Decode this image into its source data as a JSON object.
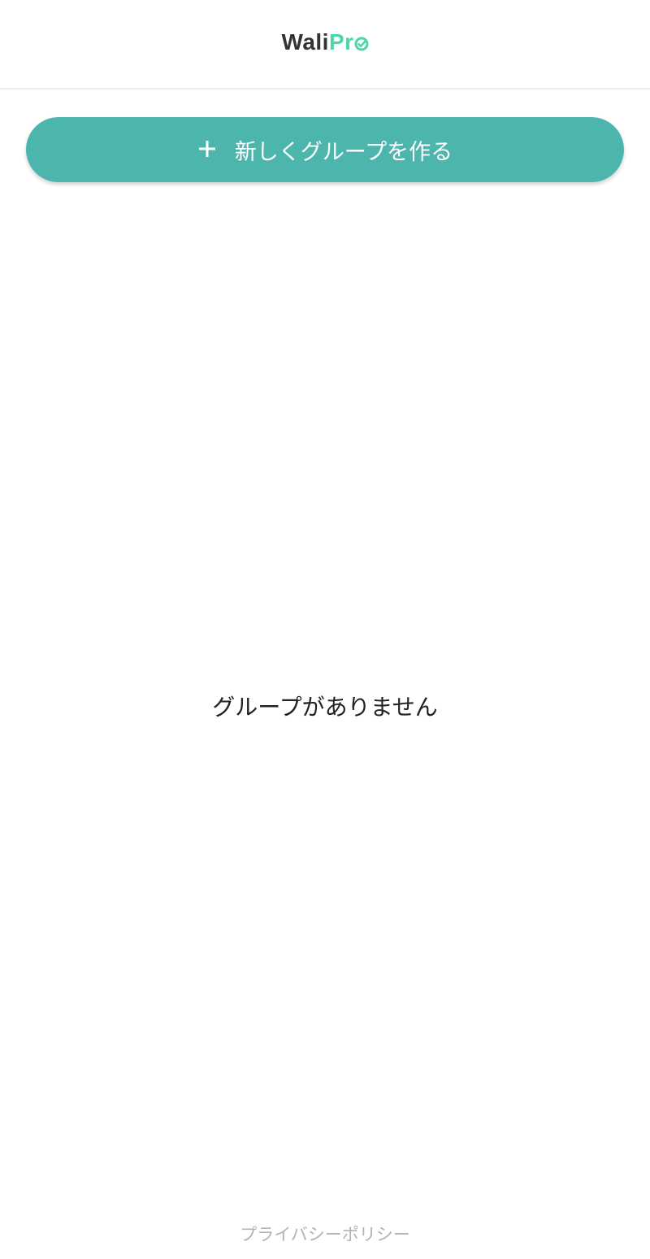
{
  "header": {
    "logo_part1": "Wali",
    "logo_part2": "Pr",
    "brand_color": "#4cd6a6",
    "logo_dark_color": "#333333"
  },
  "main": {
    "create_group_button": {
      "label": "新しくグループを作る",
      "icon": "plus-icon",
      "color": "#4db6ac"
    },
    "empty_message": "グループがありません"
  },
  "footer": {
    "privacy_link": "プライバシーポリシー"
  }
}
